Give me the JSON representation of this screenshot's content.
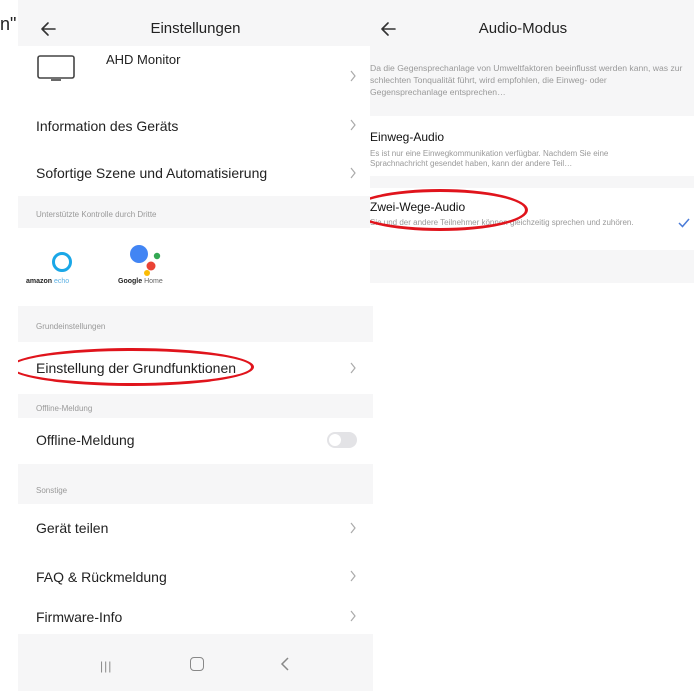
{
  "corner_text": "n\"",
  "left_screen": {
    "title": "Einstellungen",
    "device_name": "AHD Monitor",
    "items": {
      "device_info": "Information des Geräts",
      "scene_automation": "Sofortige Szene und Automatisierung"
    },
    "third_party": {
      "section_label": "Unterstützte Kontrolle durch Dritte",
      "alexa_brand": "amazon",
      "alexa_product": "echo",
      "google_brand": "Google",
      "google_product": "Home"
    },
    "basic": {
      "section_label": "Grundeinstellungen",
      "item": "Einstellung der Grundfunktionen"
    },
    "offline": {
      "section_label": "Offline-Meldung",
      "item": "Offline-Meldung",
      "enabled": false
    },
    "other": {
      "section_label": "Sonstige",
      "share": "Gerät teilen",
      "faq": "FAQ & Rückmeldung",
      "firmware": "Firmware-Info"
    },
    "nav": {
      "recents": "|||"
    }
  },
  "right_screen": {
    "title": "Audio-Modus",
    "description": "Da die Gegensprechanlage von Umweltfaktoren beeinflusst werden kann, was zur schlechten Tonqualität führt, wird empfohlen, die Einweg- oder Gegensprechanlage entsprechen…",
    "options": [
      {
        "title": "Einweg-Audio",
        "desc": "Es ist nur eine Einwegkommunikation verfügbar. Nachdem Sie eine Sprachnachricht gesendet haben, kann der andere Teil…",
        "selected": false
      },
      {
        "title": "Zwei-Wege-Audio",
        "desc": "Sie und der andere Teilnehmer können gleichzeitig sprechen und zuhören.",
        "selected": true
      }
    ]
  },
  "colors": {
    "highlight": "#e0141c",
    "accent": "#4a7bd8",
    "background": "#f6f6f7"
  }
}
